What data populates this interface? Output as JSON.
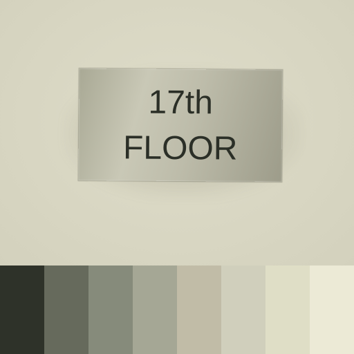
{
  "plaque": {
    "line1": "17th",
    "line2": "FLOOR"
  },
  "palette": [
    {
      "color": "#2e3229"
    },
    {
      "color": "#666a5c"
    },
    {
      "color": "#868b7b"
    },
    {
      "color": "#a5a795"
    },
    {
      "color": "#c1bca7"
    },
    {
      "color": "#d0cfbc"
    },
    {
      "color": "#dfdec6"
    },
    {
      "color": "#ecead6"
    }
  ]
}
